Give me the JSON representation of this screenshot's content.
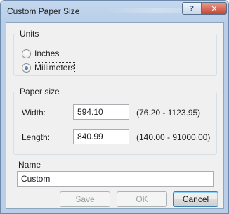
{
  "window": {
    "title": "Custom Paper Size",
    "help_glyph": "?",
    "close_glyph": "✕"
  },
  "units": {
    "legend": "Units",
    "options": [
      {
        "label": "Inches",
        "checked": false
      },
      {
        "label": "Millimeters",
        "checked": true
      }
    ]
  },
  "paper_size": {
    "legend": "Paper size",
    "width": {
      "label": "Width:",
      "value": "594.10",
      "range": "(76.20 - 1123.95)"
    },
    "length": {
      "label": "Length:",
      "value": "840.99",
      "range": "(140.00 - 91000.00)"
    }
  },
  "name": {
    "legend": "Name",
    "value": "Custom"
  },
  "buttons": {
    "save": {
      "label": "Save",
      "enabled": false
    },
    "ok": {
      "label": "OK",
      "enabled": false
    },
    "cancel": {
      "label": "Cancel",
      "enabled": true
    }
  }
}
